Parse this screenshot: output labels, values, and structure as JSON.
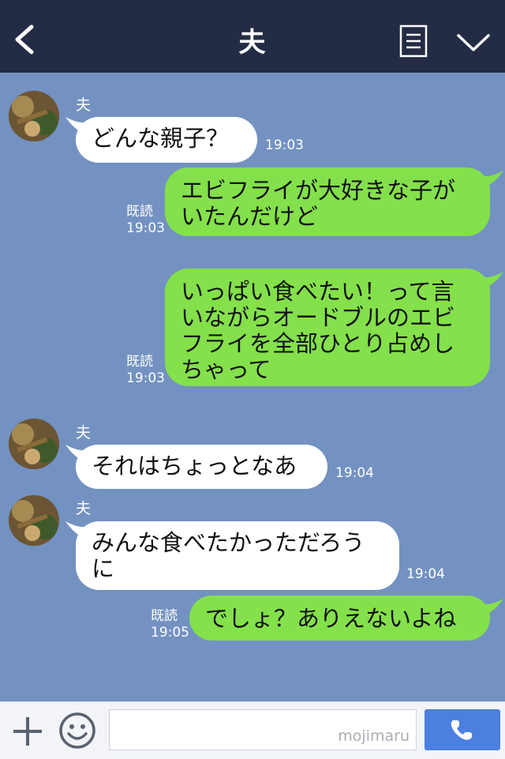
{
  "header": {
    "title": "夫",
    "back_icon": "chevron-left-icon",
    "menu_icon": "notes-icon",
    "dropdown_icon": "chevron-down-icon"
  },
  "colors": {
    "header_bg": "#232c44",
    "chat_bg": "#7392c1",
    "outgoing_bubble": "#84e04b",
    "incoming_bubble": "#ffffff",
    "call_button": "#4b7fe0"
  },
  "messages": [
    {
      "id": "m1",
      "direction": "in",
      "sender": "夫",
      "text": "どんな親子？",
      "time": "19:03"
    },
    {
      "id": "m2",
      "direction": "out",
      "read": "既読",
      "text": "エビフライが大好きな子が\nいたんだけど",
      "time": "19:03"
    },
    {
      "id": "m3",
      "direction": "out",
      "read": "既読",
      "text": "いっぱい食べたい！って言\nいながらオードブルのエビ\nフライを全部ひとり占めし\nちゃって",
      "time": "19:03"
    },
    {
      "id": "m4",
      "direction": "in",
      "sender": "夫",
      "text": "それはちょっとなあ",
      "time": "19:04"
    },
    {
      "id": "m5",
      "direction": "in",
      "sender": "夫",
      "text": "みんな食べたかっただろう\nに",
      "time": "19:04"
    },
    {
      "id": "m6",
      "direction": "out",
      "read": "既読",
      "text": "でしょ？ありえないよね",
      "time": "19:05"
    }
  ],
  "footer": {
    "input_placeholder": "",
    "watermark": "mojimaru",
    "plus_icon": "plus-icon",
    "emoji_icon": "smile-icon",
    "call_icon": "phone-icon"
  }
}
